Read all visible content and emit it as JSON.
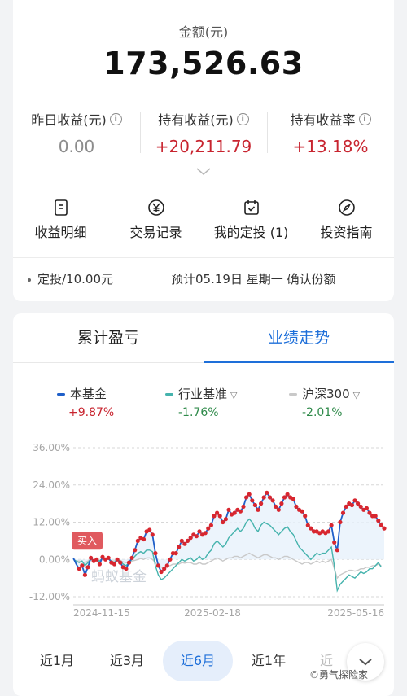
{
  "summary": {
    "amount_label": "金额(元)",
    "amount_value": "173,526.63",
    "stats": [
      {
        "label": "昨日收益(元)",
        "value": "0.00"
      },
      {
        "label": "持有收益(元)",
        "value": "+20,211.79"
      },
      {
        "label": "持有收益率",
        "value": "+13.18%"
      }
    ],
    "info_icon": "ⓘ"
  },
  "actions": [
    {
      "label": "收益明细",
      "icon": "document-icon"
    },
    {
      "label": "交易记录",
      "icon": "yen-icon"
    },
    {
      "label": "我的定投 (1)",
      "icon": "calendar-icon"
    },
    {
      "label": "投资指南",
      "icon": "compass-icon"
    }
  ],
  "plan": {
    "left": "定投/10.00元",
    "right": "预计05.19日 星期一 确认份额"
  },
  "tabs": [
    "累计盈亏",
    "业绩走势"
  ],
  "legend": [
    {
      "name": "本基金",
      "pct": "+9.87%",
      "color": "#1f5fc9",
      "pct_color": "#c8242f"
    },
    {
      "name": "行业基准",
      "pct": "-1.76%",
      "color": "#45b3ad",
      "pct_color": "#2f8a4a"
    },
    {
      "name": "沪深300",
      "pct": "-2.01%",
      "color": "#c9c9c9",
      "pct_color": "#2f8a4a"
    }
  ],
  "buy_label": "买入",
  "watermark": "蚂蚁基金",
  "chart_data": {
    "type": "line",
    "ylim": [
      -12,
      36
    ],
    "yticks": [
      "36.00%",
      "24.00%",
      "12.00%",
      "0.00%",
      "-12.00%"
    ],
    "xticks": [
      "2024-11-15",
      "2025-02-18",
      "2025-05-16"
    ],
    "series": [
      {
        "name": "本基金",
        "values": [
          0.5,
          -1.5,
          -3,
          -2,
          -5,
          -2.5,
          0.5,
          -0.5,
          0,
          -1.5,
          0.8,
          0,
          0.5,
          -1,
          -1.5,
          0,
          -1,
          -2.5,
          -3,
          -1,
          0.5,
          3,
          6,
          7,
          6.5,
          9,
          9.5,
          8,
          2,
          -2,
          -4,
          -3,
          -2,
          0,
          2,
          2,
          4,
          6,
          5,
          6,
          7,
          8,
          7.5,
          9,
          8,
          8.5,
          10,
          11,
          14,
          15,
          14,
          12,
          13,
          16,
          14.5,
          15,
          16,
          15.5,
          17,
          20,
          21,
          19,
          17.5,
          16,
          18,
          20,
          21.5,
          20,
          19,
          17,
          16,
          18,
          20,
          21,
          20,
          19.5,
          17,
          16,
          15.5,
          14,
          11,
          10,
          9,
          9,
          8.5,
          9,
          8.5,
          9,
          11,
          5.5,
          3,
          12,
          15,
          17,
          18,
          17.5,
          19,
          18,
          17,
          16,
          16.5,
          15,
          14,
          14,
          12.5,
          11,
          10
        ]
      },
      {
        "name": "行业基准",
        "values": [
          0,
          -0.5,
          -1,
          -0.5,
          -2,
          -1,
          0,
          -0.5,
          0,
          -0.5,
          0.5,
          0,
          0.3,
          -0.5,
          -1,
          0,
          -0.5,
          -1.5,
          -2,
          -1,
          0,
          1,
          2,
          2.5,
          2,
          3,
          3,
          2.5,
          -2,
          -5,
          -6.5,
          -6,
          -5,
          -4,
          -3,
          -2,
          -1,
          0,
          -0.5,
          0,
          0.5,
          -0.5,
          0,
          1,
          0,
          0.5,
          2,
          3,
          5,
          6,
          5,
          4,
          5,
          7,
          8,
          9,
          10,
          9,
          10,
          12,
          13,
          12,
          10,
          9,
          11,
          12,
          11.5,
          11,
          10,
          9,
          8,
          9,
          10,
          10.5,
          9,
          8,
          6,
          4,
          3,
          2,
          1,
          0,
          1,
          2,
          1.5,
          2,
          2,
          3,
          4,
          -2,
          -10,
          -8,
          -7,
          -6,
          -5,
          -5.5,
          -6,
          -5,
          -4,
          -4.5,
          -4,
          -3,
          -3,
          -2,
          -1,
          -2.5
        ]
      },
      {
        "name": "沪深300",
        "values": [
          0,
          -0.5,
          -0.5,
          -0.8,
          -1,
          -0.5,
          0,
          -0.3,
          0,
          -0.5,
          0,
          0,
          0,
          -0.5,
          -0.5,
          0,
          -0.3,
          -0.8,
          -1,
          -0.8,
          -0.5,
          -0.3,
          0,
          0.3,
          0,
          0.5,
          0.5,
          0,
          -1,
          -2,
          -2.5,
          -2.5,
          -2,
          -2,
          -1.5,
          -1.5,
          -1.5,
          -1,
          -1.2,
          -1,
          -1,
          -1.5,
          -1.5,
          -1,
          -1.5,
          -1.5,
          -1,
          -0.5,
          0,
          0.5,
          0,
          -0.5,
          0,
          0.5,
          0.5,
          1,
          1,
          0.5,
          1,
          1.5,
          2,
          1.5,
          1,
          0.5,
          1,
          1.5,
          1.5,
          1,
          0.5,
          0.5,
          0,
          0.5,
          1,
          1,
          0.5,
          0,
          -0.5,
          -1,
          -1.5,
          -1,
          -1,
          -1.5,
          -1,
          -0.5,
          -1,
          -0.5,
          -1,
          -0.5,
          0,
          -3,
          -6,
          -5,
          -4.5,
          -4,
          -3.5,
          -3.5,
          -3.8,
          -3.5,
          -3,
          -3,
          -2.5,
          -2.5,
          -2,
          -2,
          -1.5,
          -2
        ]
      }
    ]
  },
  "periods": [
    "近1月",
    "近3月",
    "近6月",
    "近1年",
    "近"
  ],
  "active_period": "近6月",
  "footer_watermark": "©勇气探险家"
}
